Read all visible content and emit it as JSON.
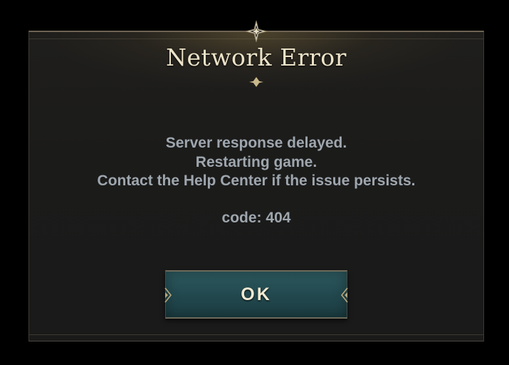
{
  "dialog": {
    "title": "Network Error",
    "message_lines": [
      "Server response delayed.",
      "Restarting game.",
      "Contact the Help Center if the issue persists."
    ],
    "code": "code: 404",
    "ok_label": "OK"
  },
  "icons": {
    "top_ornament": "four-point-star-ornament-icon",
    "divider_ornament": "diamond-ornament-icon",
    "button_corner": "arrow-ornament-icon"
  },
  "colors": {
    "background": "#000000",
    "panel": "#1b1b1a",
    "title": "#ece3c8",
    "text": "#9ea6ae",
    "button": "#22494f",
    "gold_trim": "#b8a67a"
  }
}
